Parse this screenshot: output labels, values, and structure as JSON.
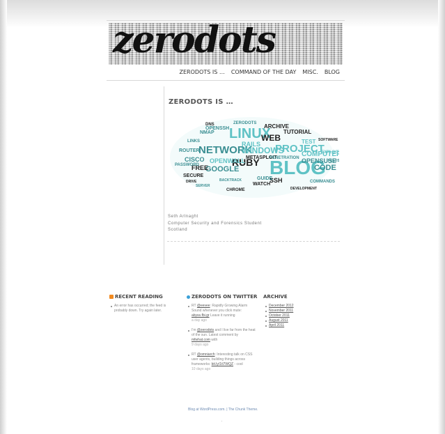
{
  "site": {
    "logo_text": "zerodots"
  },
  "nav": {
    "items": [
      "ZERODOTS IS …",
      "COMMAND OF THE DAY",
      "MISC.",
      "BLOG"
    ]
  },
  "page": {
    "title": "ZERODOTS IS …",
    "tag_cloud_words": [
      "LINUX",
      "BLOG",
      "NETWORK",
      "ARCHIVE",
      "WEB",
      "RUBY",
      "WINDOWS",
      "PROJECT",
      "CODE",
      "GOOGLE",
      "SSH",
      "RAILS",
      "CISCO",
      "FREE",
      "SECURE",
      "OPENWALL",
      "OPENSUSE",
      "TUTORIAL",
      "COMPUTER",
      "METASPLOIT",
      "PENETRATION",
      "WATCH",
      "GUIDE",
      "COMMANDS",
      "PASSWORD",
      "OPENSSH",
      "ROUTER",
      "CHROME",
      "DNS",
      "TEST",
      "LINKS",
      "DEVELOPMENT",
      "BACKTRACK",
      "SOFTWARE",
      "EXPLOIT",
      "FEEDS",
      "NMAP",
      "ZERODOTS",
      "DRIVE",
      "SERVER"
    ],
    "lines": [
      "Seth Arlnaght",
      "Computer Security and Forensics Student",
      "Scotland"
    ]
  },
  "widgets": {
    "recent_reading": {
      "title": "RECENT READING",
      "items": [
        "An error has occurred; the feed is probably down. Try again later."
      ]
    },
    "twitter": {
      "title": "ZERODOTS ON TWITTER",
      "tweets": [
        {
          "pre": "RT ",
          "mention": "@eevee",
          "text": ": Rapidly Growing Alarm Sound whenever you click mute: ",
          "link": "abyss.fbi.gr",
          "text2": " Leave it running",
          "meta": "a day ago"
        },
        {
          "pre": "I'm ",
          "mention": "@zerodots",
          "text": " and I live far from the heat of the sun. Latest comment by ",
          "link": "mfwhat.com",
          "text2": " with",
          "meta": "9 days ago"
        },
        {
          "pre": "RT ",
          "mention": "@omniarch",
          "text": ": Interesting talk on CSS user agents, building things across frameworks: ",
          "link": "bit.ly/1tl7WQZ",
          "text2": " - cool",
          "meta": "10 days ago"
        }
      ]
    },
    "archive": {
      "title": "ARCHIVE",
      "items": [
        "December 2012",
        "November 2011",
        "October 2011",
        "August 2011",
        "April 2011"
      ]
    }
  },
  "footer": {
    "credit": "Blog at WordPress.com. | The Chunk Theme.",
    "dot": "."
  },
  "colors": {
    "cloud_primary": "#5fc2c5",
    "cloud_dark": "#222222",
    "cloud_mid": "#3a8e92"
  }
}
